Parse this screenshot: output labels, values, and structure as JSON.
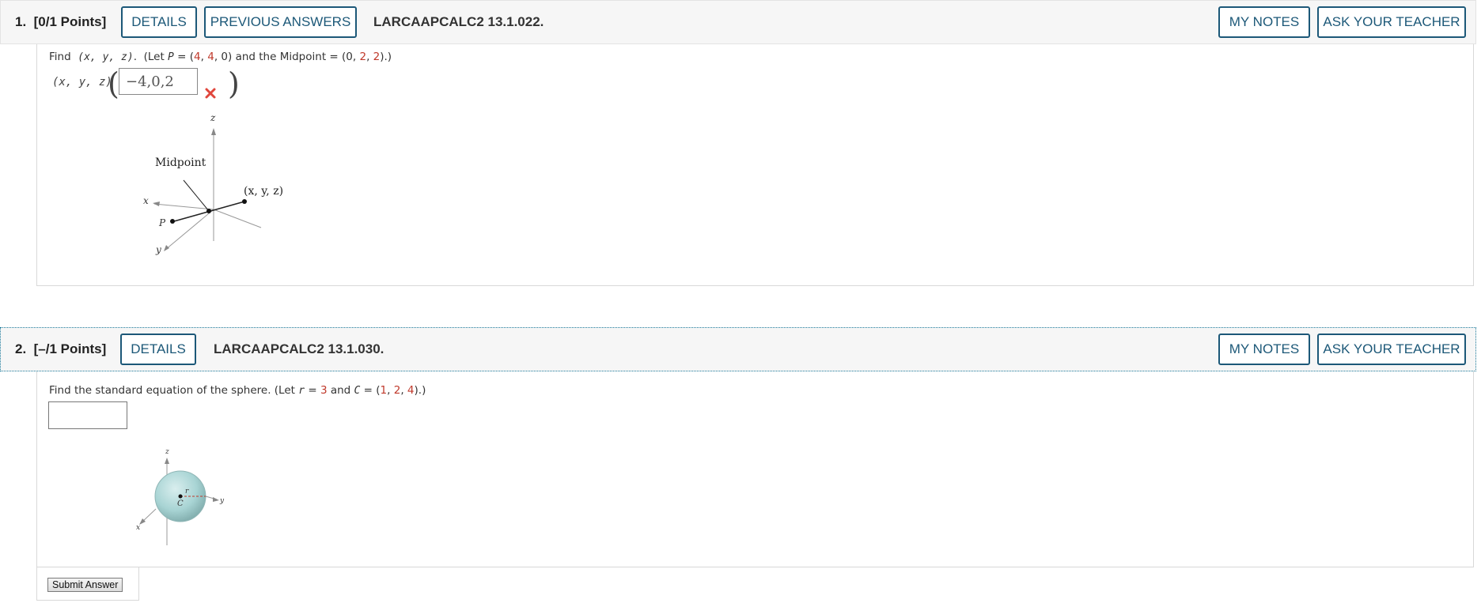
{
  "questions": [
    {
      "number": "1.",
      "points": "[0/1 Points]",
      "details_label": "DETAILS",
      "previous_answers_label": "PREVIOUS ANSWERS",
      "question_id": "LARCAAPCALC2 13.1.022.",
      "my_notes_label": "MY NOTES",
      "ask_teacher_label": "ASK YOUR TEACHER",
      "prompt": {
        "find_text": "Find",
        "target": "(x, y, z)",
        "let_text": "(Let",
        "p_label": "P",
        "p_values": [
          "4",
          "4",
          "0"
        ],
        "midpoint_text": "and the Midpoint =",
        "midpoint_values": [
          "0",
          "2",
          "2"
        ]
      },
      "answer_label": "(x, y, z) =",
      "answer_value": "−4,0,2",
      "answer_status": "incorrect",
      "figure_labels": {
        "z": "z",
        "x": "x",
        "y": "y",
        "p": "P",
        "midpoint": "Midpoint",
        "point": "(x, y, z)"
      }
    },
    {
      "number": "2.",
      "points": "[–/1 Points]",
      "details_label": "DETAILS",
      "question_id": "LARCAAPCALC2 13.1.030.",
      "my_notes_label": "MY NOTES",
      "ask_teacher_label": "ASK YOUR TEACHER",
      "prompt": {
        "text": "Find the standard equation of the sphere. (Let",
        "r_label": "r",
        "r_value": "3",
        "c_label": "C",
        "c_values": [
          "1",
          "2",
          "4"
        ]
      },
      "answer_value": "",
      "figure_labels": {
        "z": "z",
        "x": "x",
        "y": "y",
        "r": "r",
        "c": "C"
      }
    }
  ],
  "submit_label": "Submit Answer",
  "colors": {
    "button_border": "#1c5878",
    "given_value": "#c0392b",
    "wrong_mark": "#e0463c",
    "sphere_fill": "#a8d4d4"
  }
}
